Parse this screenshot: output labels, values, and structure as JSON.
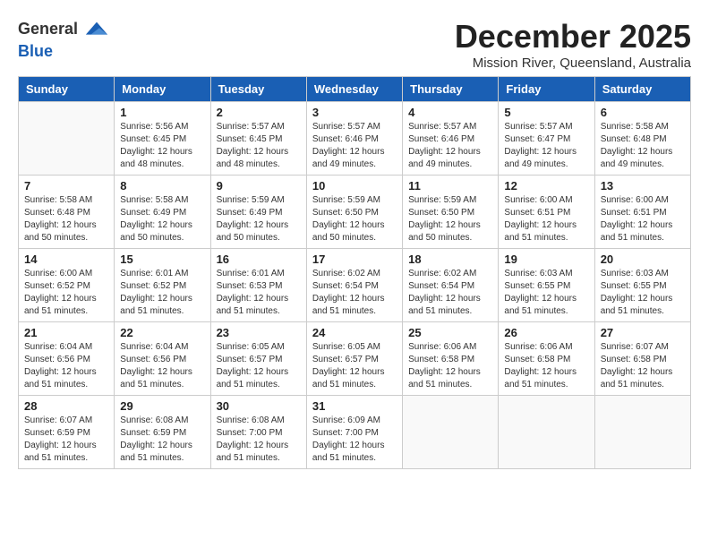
{
  "logo": {
    "text_general": "General",
    "text_blue": "Blue"
  },
  "title": "December 2025",
  "subtitle": "Mission River, Queensland, Australia",
  "header": {
    "accent_color": "#1a5fb4"
  },
  "days_of_week": [
    "Sunday",
    "Monday",
    "Tuesday",
    "Wednesday",
    "Thursday",
    "Friday",
    "Saturday"
  ],
  "weeks": [
    [
      {
        "day": "",
        "sunrise": "",
        "sunset": "",
        "daylight": ""
      },
      {
        "day": "1",
        "sunrise": "Sunrise: 5:56 AM",
        "sunset": "Sunset: 6:45 PM",
        "daylight": "Daylight: 12 hours and 48 minutes."
      },
      {
        "day": "2",
        "sunrise": "Sunrise: 5:57 AM",
        "sunset": "Sunset: 6:45 PM",
        "daylight": "Daylight: 12 hours and 48 minutes."
      },
      {
        "day": "3",
        "sunrise": "Sunrise: 5:57 AM",
        "sunset": "Sunset: 6:46 PM",
        "daylight": "Daylight: 12 hours and 49 minutes."
      },
      {
        "day": "4",
        "sunrise": "Sunrise: 5:57 AM",
        "sunset": "Sunset: 6:46 PM",
        "daylight": "Daylight: 12 hours and 49 minutes."
      },
      {
        "day": "5",
        "sunrise": "Sunrise: 5:57 AM",
        "sunset": "Sunset: 6:47 PM",
        "daylight": "Daylight: 12 hours and 49 minutes."
      },
      {
        "day": "6",
        "sunrise": "Sunrise: 5:58 AM",
        "sunset": "Sunset: 6:48 PM",
        "daylight": "Daylight: 12 hours and 49 minutes."
      }
    ],
    [
      {
        "day": "7",
        "sunrise": "Sunrise: 5:58 AM",
        "sunset": "Sunset: 6:48 PM",
        "daylight": "Daylight: 12 hours and 50 minutes."
      },
      {
        "day": "8",
        "sunrise": "Sunrise: 5:58 AM",
        "sunset": "Sunset: 6:49 PM",
        "daylight": "Daylight: 12 hours and 50 minutes."
      },
      {
        "day": "9",
        "sunrise": "Sunrise: 5:59 AM",
        "sunset": "Sunset: 6:49 PM",
        "daylight": "Daylight: 12 hours and 50 minutes."
      },
      {
        "day": "10",
        "sunrise": "Sunrise: 5:59 AM",
        "sunset": "Sunset: 6:50 PM",
        "daylight": "Daylight: 12 hours and 50 minutes."
      },
      {
        "day": "11",
        "sunrise": "Sunrise: 5:59 AM",
        "sunset": "Sunset: 6:50 PM",
        "daylight": "Daylight: 12 hours and 50 minutes."
      },
      {
        "day": "12",
        "sunrise": "Sunrise: 6:00 AM",
        "sunset": "Sunset: 6:51 PM",
        "daylight": "Daylight: 12 hours and 51 minutes."
      },
      {
        "day": "13",
        "sunrise": "Sunrise: 6:00 AM",
        "sunset": "Sunset: 6:51 PM",
        "daylight": "Daylight: 12 hours and 51 minutes."
      }
    ],
    [
      {
        "day": "14",
        "sunrise": "Sunrise: 6:00 AM",
        "sunset": "Sunset: 6:52 PM",
        "daylight": "Daylight: 12 hours and 51 minutes."
      },
      {
        "day": "15",
        "sunrise": "Sunrise: 6:01 AM",
        "sunset": "Sunset: 6:52 PM",
        "daylight": "Daylight: 12 hours and 51 minutes."
      },
      {
        "day": "16",
        "sunrise": "Sunrise: 6:01 AM",
        "sunset": "Sunset: 6:53 PM",
        "daylight": "Daylight: 12 hours and 51 minutes."
      },
      {
        "day": "17",
        "sunrise": "Sunrise: 6:02 AM",
        "sunset": "Sunset: 6:54 PM",
        "daylight": "Daylight: 12 hours and 51 minutes."
      },
      {
        "day": "18",
        "sunrise": "Sunrise: 6:02 AM",
        "sunset": "Sunset: 6:54 PM",
        "daylight": "Daylight: 12 hours and 51 minutes."
      },
      {
        "day": "19",
        "sunrise": "Sunrise: 6:03 AM",
        "sunset": "Sunset: 6:55 PM",
        "daylight": "Daylight: 12 hours and 51 minutes."
      },
      {
        "day": "20",
        "sunrise": "Sunrise: 6:03 AM",
        "sunset": "Sunset: 6:55 PM",
        "daylight": "Daylight: 12 hours and 51 minutes."
      }
    ],
    [
      {
        "day": "21",
        "sunrise": "Sunrise: 6:04 AM",
        "sunset": "Sunset: 6:56 PM",
        "daylight": "Daylight: 12 hours and 51 minutes."
      },
      {
        "day": "22",
        "sunrise": "Sunrise: 6:04 AM",
        "sunset": "Sunset: 6:56 PM",
        "daylight": "Daylight: 12 hours and 51 minutes."
      },
      {
        "day": "23",
        "sunrise": "Sunrise: 6:05 AM",
        "sunset": "Sunset: 6:57 PM",
        "daylight": "Daylight: 12 hours and 51 minutes."
      },
      {
        "day": "24",
        "sunrise": "Sunrise: 6:05 AM",
        "sunset": "Sunset: 6:57 PM",
        "daylight": "Daylight: 12 hours and 51 minutes."
      },
      {
        "day": "25",
        "sunrise": "Sunrise: 6:06 AM",
        "sunset": "Sunset: 6:58 PM",
        "daylight": "Daylight: 12 hours and 51 minutes."
      },
      {
        "day": "26",
        "sunrise": "Sunrise: 6:06 AM",
        "sunset": "Sunset: 6:58 PM",
        "daylight": "Daylight: 12 hours and 51 minutes."
      },
      {
        "day": "27",
        "sunrise": "Sunrise: 6:07 AM",
        "sunset": "Sunset: 6:58 PM",
        "daylight": "Daylight: 12 hours and 51 minutes."
      }
    ],
    [
      {
        "day": "28",
        "sunrise": "Sunrise: 6:07 AM",
        "sunset": "Sunset: 6:59 PM",
        "daylight": "Daylight: 12 hours and 51 minutes."
      },
      {
        "day": "29",
        "sunrise": "Sunrise: 6:08 AM",
        "sunset": "Sunset: 6:59 PM",
        "daylight": "Daylight: 12 hours and 51 minutes."
      },
      {
        "day": "30",
        "sunrise": "Sunrise: 6:08 AM",
        "sunset": "Sunset: 7:00 PM",
        "daylight": "Daylight: 12 hours and 51 minutes."
      },
      {
        "day": "31",
        "sunrise": "Sunrise: 6:09 AM",
        "sunset": "Sunset: 7:00 PM",
        "daylight": "Daylight: 12 hours and 51 minutes."
      },
      {
        "day": "",
        "sunrise": "",
        "sunset": "",
        "daylight": ""
      },
      {
        "day": "",
        "sunrise": "",
        "sunset": "",
        "daylight": ""
      },
      {
        "day": "",
        "sunrise": "",
        "sunset": "",
        "daylight": ""
      }
    ]
  ]
}
